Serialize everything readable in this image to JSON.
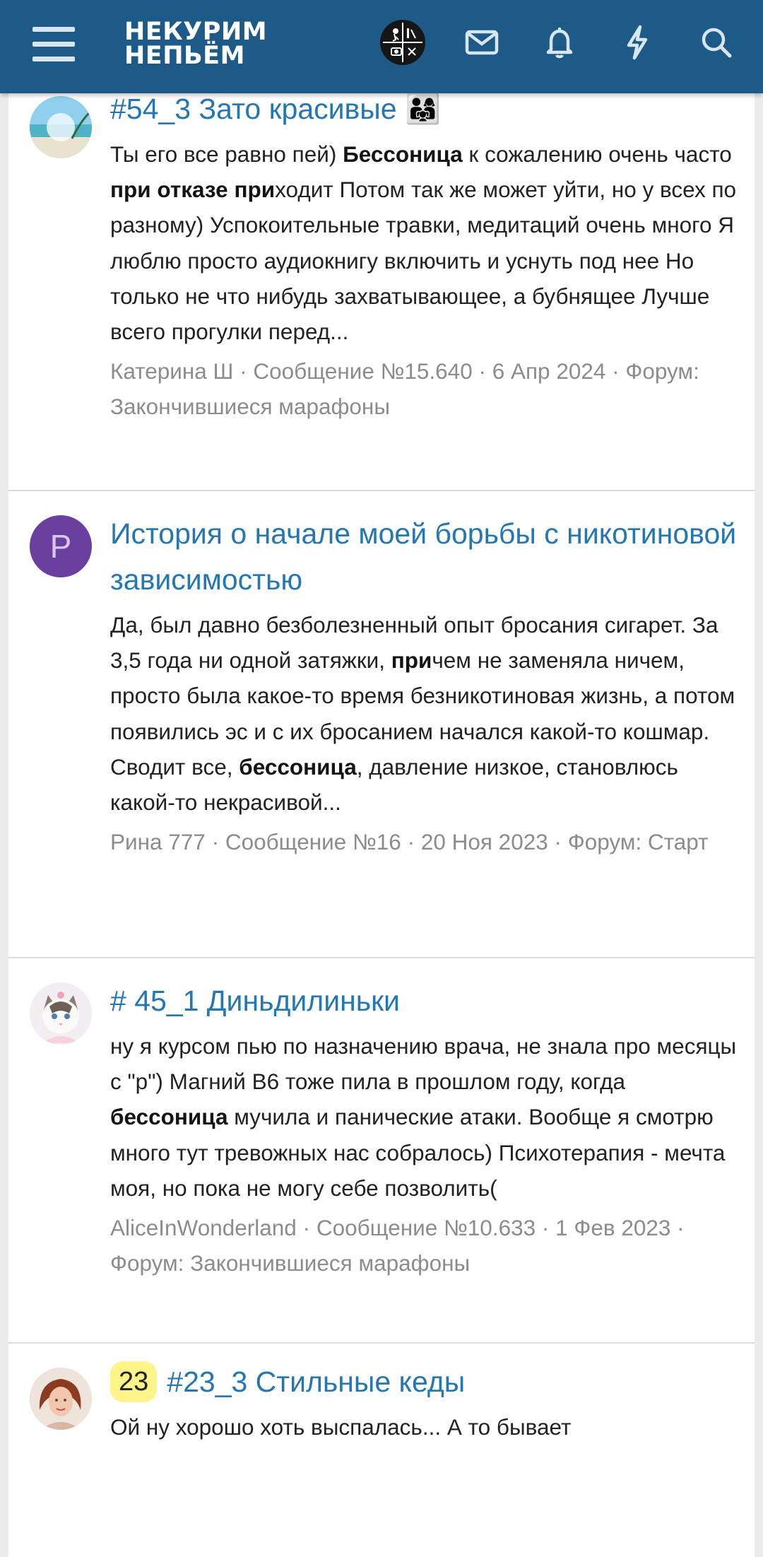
{
  "header": {
    "logo_line1": "НЕКУРИМ",
    "logo_line2": "НЕПЬЁМ",
    "icons": [
      "menu-icon",
      "avatar",
      "mail-icon",
      "bell-icon",
      "bolt-icon",
      "search-icon"
    ],
    "background": "#1e5a87"
  },
  "results": [
    {
      "title": "#54_3 Зато красивые 👨‍👩‍👧",
      "snippet_parts": [
        {
          "text": "Ты его все равно пей) ",
          "bold": false
        },
        {
          "text": "Бессоница",
          "bold": true
        },
        {
          "text": " к сожалению очень часто ",
          "bold": false
        },
        {
          "text": "при отказе при",
          "bold": true
        },
        {
          "text": "ходит Потом так же может уйти, но у всех по разному) Успокоительные травки, медитаций очень много Я люблю просто аудиокнигу включить и уснуть под нее Но только не что нибудь захватывающее, а бубнящее Лучше всего прогулки перед...",
          "bold": false
        }
      ],
      "meta": "Катерина Ш · Сообщение №15.640 · 6 Апр 2024 · Форум: Закончившиеся марафоны",
      "avatar_type": "image-beach"
    },
    {
      "title": "История о начале моей борьбы с никотиновой зависимостью",
      "snippet_parts": [
        {
          "text": "Да, был давно безболезненный опыт бросания сигарет. За 3,5 года ни одной затяжки, ",
          "bold": false
        },
        {
          "text": "при",
          "bold": true
        },
        {
          "text": "чем не заменяла ничем, просто была какое-то время безникотиновая жизнь, а потом появились эс и с их бросанием начался какой-то кошмар. Сводит все, ",
          "bold": false
        },
        {
          "text": "бессоница",
          "bold": true
        },
        {
          "text": ", давление низкое, становлюсь какой-то некрасивой...",
          "bold": false
        }
      ],
      "meta": "Рина 777 · Сообщение №16 · 20 Ноя 2023 · Форум: Старт",
      "avatar_type": "letter",
      "avatar_letter": "Р"
    },
    {
      "title": "# 45_1 Диньдилиньки",
      "snippet_parts": [
        {
          "text": "ну я курсом пью по назначению врача, не знала про месяцы с \"р\") Магний В6 тоже пила в прошлом году, когда ",
          "bold": false
        },
        {
          "text": "бессоница",
          "bold": true
        },
        {
          "text": " мучила и панические атаки. Вообще я смотрю много тут тревожных нас собралось) Психотерапия - мечта моя, но пока не могу себе позволить(",
          "bold": false
        }
      ],
      "meta": "AliceInWonderland · Сообщение №10.633 · 1 Фев 2023 · Форум: Закончившиеся марафоны",
      "avatar_type": "image-cat"
    },
    {
      "badge": "23",
      "title": "#23_3 Стильные кеды",
      "snippet_parts": [
        {
          "text": "Ой ну хорошо хоть выспалась... А то бывает",
          "bold": false
        }
      ],
      "meta": "",
      "avatar_type": "image-woman"
    }
  ]
}
